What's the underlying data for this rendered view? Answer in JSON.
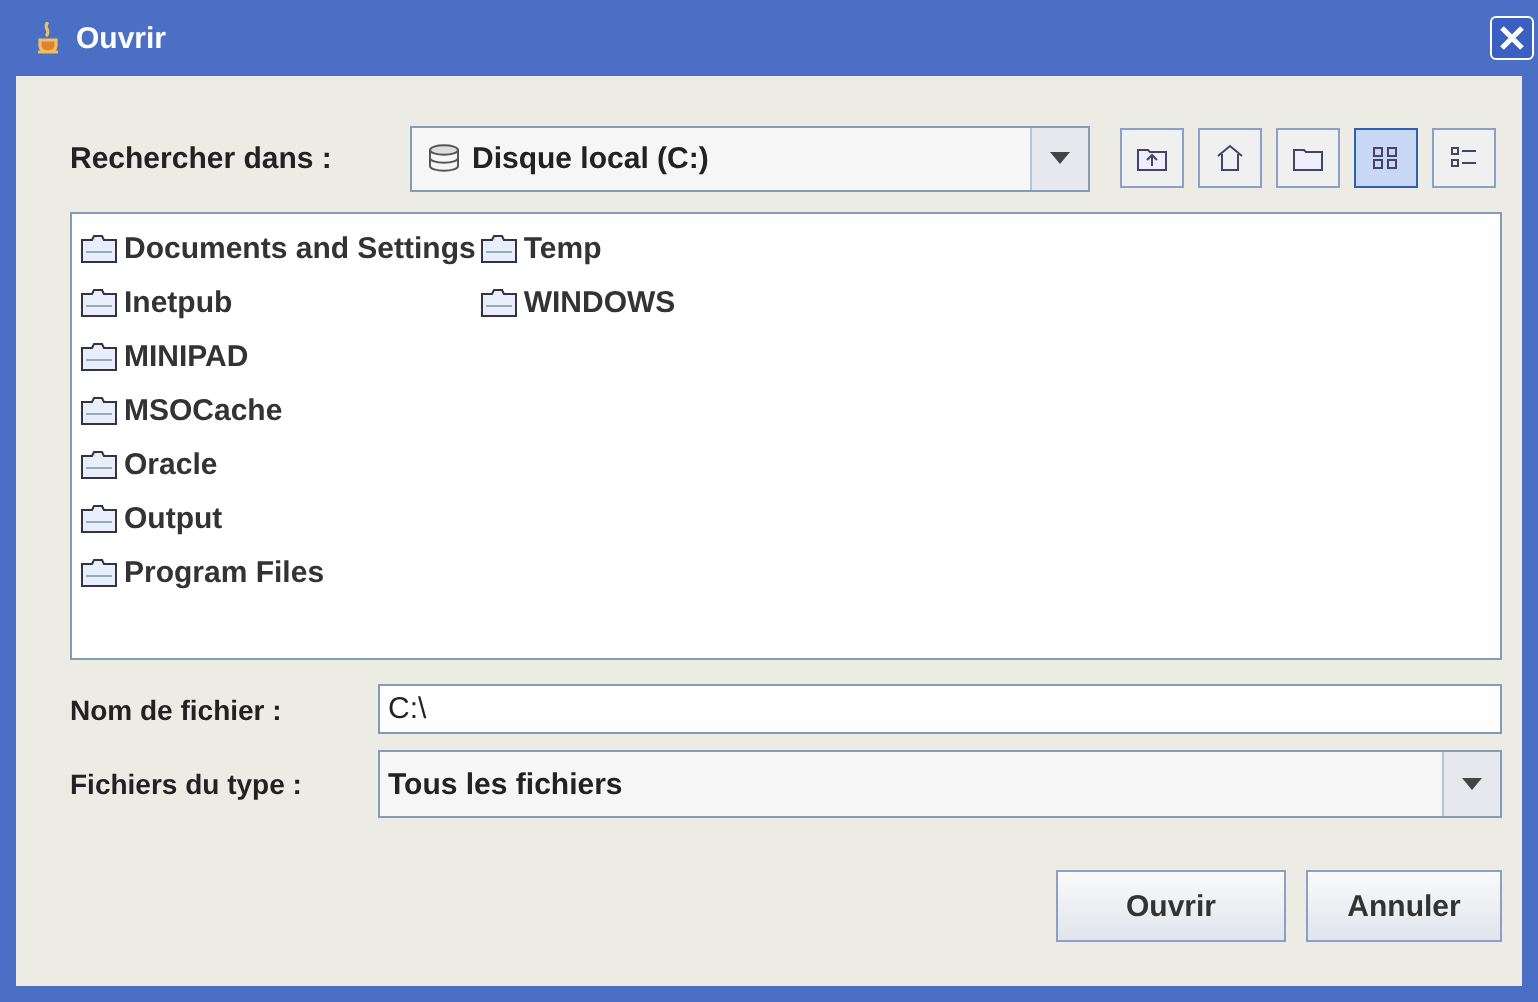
{
  "window": {
    "title": "Ouvrir"
  },
  "look_in": {
    "label": "Rechercher dans :",
    "value": "Disque local (C:)"
  },
  "toolbar": [
    {
      "kind": "up",
      "selected": false
    },
    {
      "kind": "home",
      "selected": false
    },
    {
      "kind": "new-folder",
      "selected": false
    },
    {
      "kind": "list",
      "selected": true
    },
    {
      "kind": "details",
      "selected": false
    }
  ],
  "files": [
    "Documents and Settings",
    "Inetpub",
    "MINIPAD",
    "MSOCache",
    "Oracle",
    "Output",
    "Program Files",
    "Temp",
    "WINDOWS"
  ],
  "file_name": {
    "label": "Nom de fichier :",
    "value": "C:\\"
  },
  "file_type": {
    "label": "Fichiers du type :",
    "value": "Tous les fichiers"
  },
  "buttons": [
    "Ouvrir",
    "Annuler"
  ]
}
